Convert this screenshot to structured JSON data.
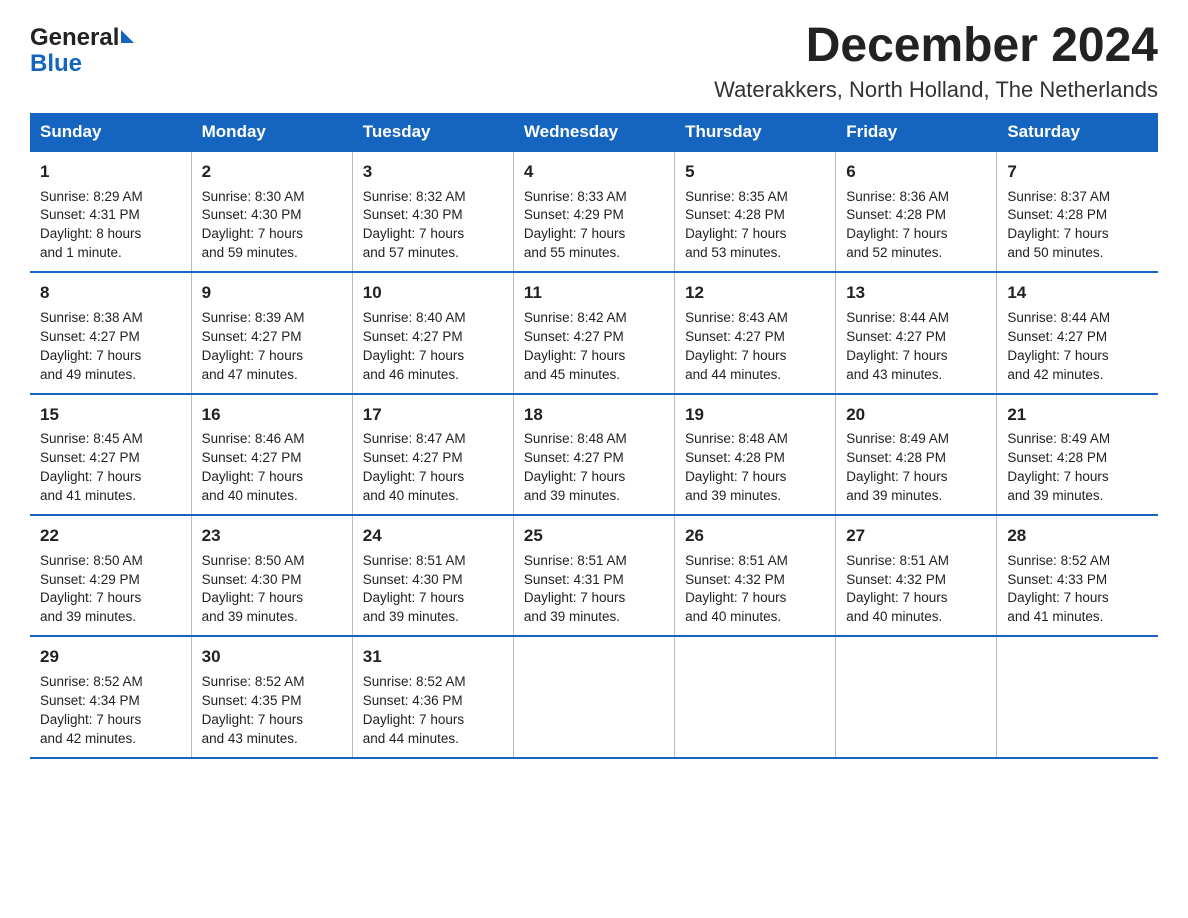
{
  "header": {
    "logo_text_general": "General",
    "logo_text_blue": "Blue",
    "main_title": "December 2024",
    "subtitle": "Waterakkers, North Holland, The Netherlands"
  },
  "calendar": {
    "days_of_week": [
      "Sunday",
      "Monday",
      "Tuesday",
      "Wednesday",
      "Thursday",
      "Friday",
      "Saturday"
    ],
    "weeks": [
      [
        {
          "day": "1",
          "info": "Sunrise: 8:29 AM\nSunset: 4:31 PM\nDaylight: 8 hours\nand 1 minute."
        },
        {
          "day": "2",
          "info": "Sunrise: 8:30 AM\nSunset: 4:30 PM\nDaylight: 7 hours\nand 59 minutes."
        },
        {
          "day": "3",
          "info": "Sunrise: 8:32 AM\nSunset: 4:30 PM\nDaylight: 7 hours\nand 57 minutes."
        },
        {
          "day": "4",
          "info": "Sunrise: 8:33 AM\nSunset: 4:29 PM\nDaylight: 7 hours\nand 55 minutes."
        },
        {
          "day": "5",
          "info": "Sunrise: 8:35 AM\nSunset: 4:28 PM\nDaylight: 7 hours\nand 53 minutes."
        },
        {
          "day": "6",
          "info": "Sunrise: 8:36 AM\nSunset: 4:28 PM\nDaylight: 7 hours\nand 52 minutes."
        },
        {
          "day": "7",
          "info": "Sunrise: 8:37 AM\nSunset: 4:28 PM\nDaylight: 7 hours\nand 50 minutes."
        }
      ],
      [
        {
          "day": "8",
          "info": "Sunrise: 8:38 AM\nSunset: 4:27 PM\nDaylight: 7 hours\nand 49 minutes."
        },
        {
          "day": "9",
          "info": "Sunrise: 8:39 AM\nSunset: 4:27 PM\nDaylight: 7 hours\nand 47 minutes."
        },
        {
          "day": "10",
          "info": "Sunrise: 8:40 AM\nSunset: 4:27 PM\nDaylight: 7 hours\nand 46 minutes."
        },
        {
          "day": "11",
          "info": "Sunrise: 8:42 AM\nSunset: 4:27 PM\nDaylight: 7 hours\nand 45 minutes."
        },
        {
          "day": "12",
          "info": "Sunrise: 8:43 AM\nSunset: 4:27 PM\nDaylight: 7 hours\nand 44 minutes."
        },
        {
          "day": "13",
          "info": "Sunrise: 8:44 AM\nSunset: 4:27 PM\nDaylight: 7 hours\nand 43 minutes."
        },
        {
          "day": "14",
          "info": "Sunrise: 8:44 AM\nSunset: 4:27 PM\nDaylight: 7 hours\nand 42 minutes."
        }
      ],
      [
        {
          "day": "15",
          "info": "Sunrise: 8:45 AM\nSunset: 4:27 PM\nDaylight: 7 hours\nand 41 minutes."
        },
        {
          "day": "16",
          "info": "Sunrise: 8:46 AM\nSunset: 4:27 PM\nDaylight: 7 hours\nand 40 minutes."
        },
        {
          "day": "17",
          "info": "Sunrise: 8:47 AM\nSunset: 4:27 PM\nDaylight: 7 hours\nand 40 minutes."
        },
        {
          "day": "18",
          "info": "Sunrise: 8:48 AM\nSunset: 4:27 PM\nDaylight: 7 hours\nand 39 minutes."
        },
        {
          "day": "19",
          "info": "Sunrise: 8:48 AM\nSunset: 4:28 PM\nDaylight: 7 hours\nand 39 minutes."
        },
        {
          "day": "20",
          "info": "Sunrise: 8:49 AM\nSunset: 4:28 PM\nDaylight: 7 hours\nand 39 minutes."
        },
        {
          "day": "21",
          "info": "Sunrise: 8:49 AM\nSunset: 4:28 PM\nDaylight: 7 hours\nand 39 minutes."
        }
      ],
      [
        {
          "day": "22",
          "info": "Sunrise: 8:50 AM\nSunset: 4:29 PM\nDaylight: 7 hours\nand 39 minutes."
        },
        {
          "day": "23",
          "info": "Sunrise: 8:50 AM\nSunset: 4:30 PM\nDaylight: 7 hours\nand 39 minutes."
        },
        {
          "day": "24",
          "info": "Sunrise: 8:51 AM\nSunset: 4:30 PM\nDaylight: 7 hours\nand 39 minutes."
        },
        {
          "day": "25",
          "info": "Sunrise: 8:51 AM\nSunset: 4:31 PM\nDaylight: 7 hours\nand 39 minutes."
        },
        {
          "day": "26",
          "info": "Sunrise: 8:51 AM\nSunset: 4:32 PM\nDaylight: 7 hours\nand 40 minutes."
        },
        {
          "day": "27",
          "info": "Sunrise: 8:51 AM\nSunset: 4:32 PM\nDaylight: 7 hours\nand 40 minutes."
        },
        {
          "day": "28",
          "info": "Sunrise: 8:52 AM\nSunset: 4:33 PM\nDaylight: 7 hours\nand 41 minutes."
        }
      ],
      [
        {
          "day": "29",
          "info": "Sunrise: 8:52 AM\nSunset: 4:34 PM\nDaylight: 7 hours\nand 42 minutes."
        },
        {
          "day": "30",
          "info": "Sunrise: 8:52 AM\nSunset: 4:35 PM\nDaylight: 7 hours\nand 43 minutes."
        },
        {
          "day": "31",
          "info": "Sunrise: 8:52 AM\nSunset: 4:36 PM\nDaylight: 7 hours\nand 44 minutes."
        },
        {
          "day": "",
          "info": ""
        },
        {
          "day": "",
          "info": ""
        },
        {
          "day": "",
          "info": ""
        },
        {
          "day": "",
          "info": ""
        }
      ]
    ]
  }
}
